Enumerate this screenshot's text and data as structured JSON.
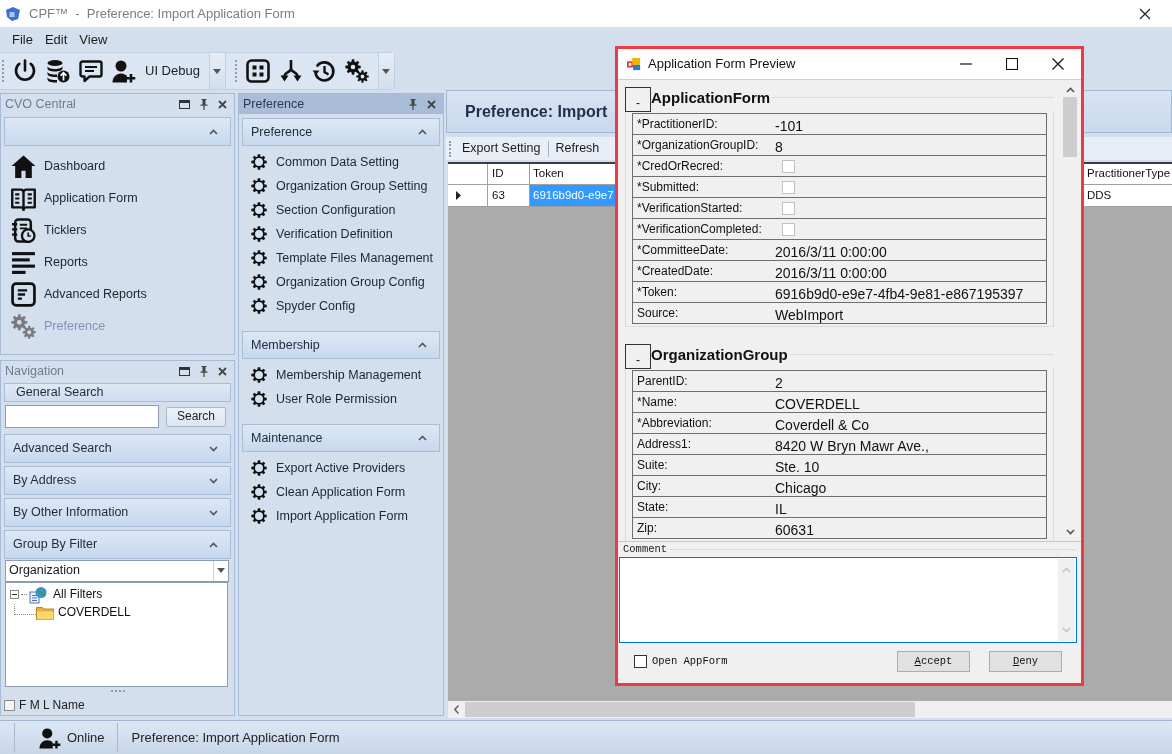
{
  "window": {
    "title": "CPF™  -  Preference: Import Application Form"
  },
  "menu": [
    {
      "label": "File"
    },
    {
      "label": "Edit"
    },
    {
      "label": "View"
    }
  ],
  "toolbar": {
    "debug_label": "UI Debug"
  },
  "cvo_central": {
    "title": "CVO Central",
    "group_expanded": true,
    "items": [
      {
        "label": "Dashboard",
        "kind": "dashboard",
        "selected": false
      },
      {
        "label": "Application Form",
        "kind": "form",
        "selected": false
      },
      {
        "label": "Ticklers",
        "kind": "ticklers",
        "selected": false
      },
      {
        "label": "Reports",
        "kind": "reports",
        "selected": false
      },
      {
        "label": "Advanced Reports",
        "kind": "advanced-reports",
        "selected": false
      },
      {
        "label": "Preference",
        "kind": "preference",
        "selected": true
      }
    ]
  },
  "navigation": {
    "title": "Navigation",
    "general_search": {
      "title": "General Search",
      "button": "Search"
    },
    "sections": [
      {
        "title": "Advanced Search",
        "expanded": false
      },
      {
        "title": "By Address",
        "expanded": false
      },
      {
        "title": "By Other Information",
        "expanded": false
      },
      {
        "title": "Group By Filter",
        "expanded": true
      }
    ],
    "group_by": {
      "value": "Organization"
    },
    "tree": [
      {
        "label": "All Filters",
        "kind": "root",
        "expanded": true,
        "children": [
          {
            "label": "COVERDELL",
            "kind": "folder"
          }
        ]
      }
    ],
    "name_option": {
      "label": "F M L Name",
      "checked": false
    }
  },
  "preference_panel": {
    "title": "Preference",
    "groups": [
      {
        "title": "Preference",
        "expanded": true,
        "items": [
          {
            "label": "Common Data Setting"
          },
          {
            "label": "Organization Group Setting"
          },
          {
            "label": "Section Configuration"
          },
          {
            "label": "Verification Definition"
          },
          {
            "label": "Template Files Management"
          },
          {
            "label": "Organization Group Config"
          },
          {
            "label": "Spyder Config"
          }
        ]
      },
      {
        "title": "Membership",
        "expanded": true,
        "items": [
          {
            "label": "Membership Management"
          },
          {
            "label": "User Role Permission"
          }
        ]
      },
      {
        "title": "Maintenance",
        "expanded": true,
        "items": [
          {
            "label": "Export Active Providers"
          },
          {
            "label": "Clean Application Form"
          },
          {
            "label": "Import Application Form"
          }
        ]
      }
    ]
  },
  "main": {
    "title": "Preference: Import",
    "toolbar": [
      {
        "label": "Export Setting"
      },
      {
        "label": "Refresh"
      }
    ],
    "table": {
      "columns": [
        "ID",
        "Token",
        "PractitionerType"
      ],
      "rows": [
        {
          "current": true,
          "cells": [
            {
              "text": "63",
              "selected": false
            },
            {
              "text": "6916b9d0-e9e7",
              "selected": true
            },
            {
              "text": "DDS",
              "selected": false
            }
          ]
        }
      ]
    }
  },
  "dialog": {
    "title": "Application Form Preview",
    "sections": [
      {
        "title": "ApplicationForm",
        "toggle": "-",
        "fields": [
          {
            "label": "*PractitionerID:",
            "kind": "text",
            "value": "-101"
          },
          {
            "label": "*OrganizationGroupID:",
            "kind": "text",
            "value": "8"
          },
          {
            "label": "*CredOrRecred:",
            "kind": "checkbox",
            "checked": false
          },
          {
            "label": "*Submitted:",
            "kind": "checkbox",
            "checked": false
          },
          {
            "label": "*VerificationStarted:",
            "kind": "checkbox",
            "checked": false
          },
          {
            "label": "*VerificationCompleted:",
            "kind": "checkbox",
            "checked": false
          },
          {
            "label": "*CommitteeDate:",
            "kind": "text",
            "value": "2016/3/11 0:00:00"
          },
          {
            "label": "*CreatedDate:",
            "kind": "text",
            "value": "2016/3/11 0:00:00"
          },
          {
            "label": "*Token:",
            "kind": "text",
            "value": "6916b9d0-e9e7-4fb4-9e81-e867195397"
          },
          {
            "label": "Source:",
            "kind": "text",
            "value": "WebImport"
          }
        ]
      },
      {
        "title": "OrganizationGroup",
        "toggle": "-",
        "fields": [
          {
            "label": "ParentID:",
            "kind": "text",
            "value": "2"
          },
          {
            "label": "*Name:",
            "kind": "text",
            "value": "COVERDELL"
          },
          {
            "label": "*Abbreviation:",
            "kind": "text",
            "value": "Coverdell & Co"
          },
          {
            "label": "Address1:",
            "kind": "text",
            "value": "8420 W Bryn Mawr Ave.,"
          },
          {
            "label": "Suite:",
            "kind": "text",
            "value": "Ste. 10"
          },
          {
            "label": "City:",
            "kind": "text",
            "value": "Chicago"
          },
          {
            "label": "State:",
            "kind": "text",
            "value": "IL"
          },
          {
            "label": "Zip:",
            "kind": "text",
            "value": "60631"
          }
        ]
      }
    ],
    "comment": {
      "label": "Comment"
    },
    "open_appform": {
      "label": "Open AppForm",
      "checked": false
    },
    "buttons": [
      {
        "label": "Accept"
      },
      {
        "label": "Deny"
      }
    ]
  },
  "status_bar": {
    "user_status": "Online",
    "page": "Preference: Import Application Form"
  }
}
